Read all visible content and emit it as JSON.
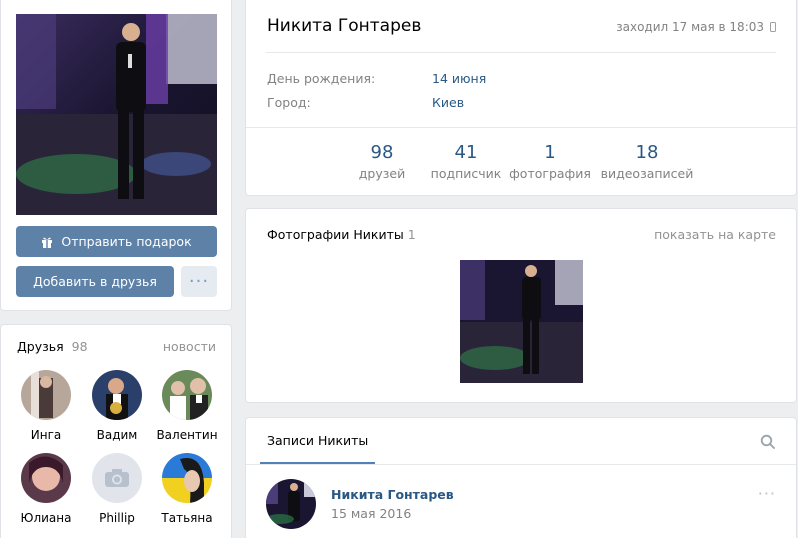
{
  "profile": {
    "name": "Никита Гонтарев",
    "last_seen": "заходил 17 мая в 18:03",
    "birthday_label": "День рождения:",
    "birthday_value": "14 июня",
    "city_label": "Город:",
    "city_value": "Киев"
  },
  "buttons": {
    "gift": "Отправить подарок",
    "add_friend": "Добавить в друзья",
    "more": "···"
  },
  "stats": [
    {
      "num": "98",
      "label": "друзей"
    },
    {
      "num": "41",
      "label": "подписчик"
    },
    {
      "num": "1",
      "label": "фотография"
    },
    {
      "num": "18",
      "label": "видеозаписей"
    }
  ],
  "friends": {
    "title": "Друзья",
    "count": "98",
    "link": "новости",
    "items": [
      {
        "name": "Инга"
      },
      {
        "name": "Вадим"
      },
      {
        "name": "Валентин"
      },
      {
        "name": "Юлиана"
      },
      {
        "name": "Phillip"
      },
      {
        "name": "Татьяна"
      }
    ]
  },
  "photos": {
    "title": "Фотографии Никиты",
    "count": "1",
    "map_link": "показать на карте"
  },
  "wall": {
    "tab": "Записи Никиты",
    "post_author": "Никита Гонтарев",
    "post_date": "15 мая 2016",
    "more": "···"
  },
  "colors": {
    "accent": "#5e81a8",
    "link": "#2a5885",
    "background": "#edeef0"
  }
}
